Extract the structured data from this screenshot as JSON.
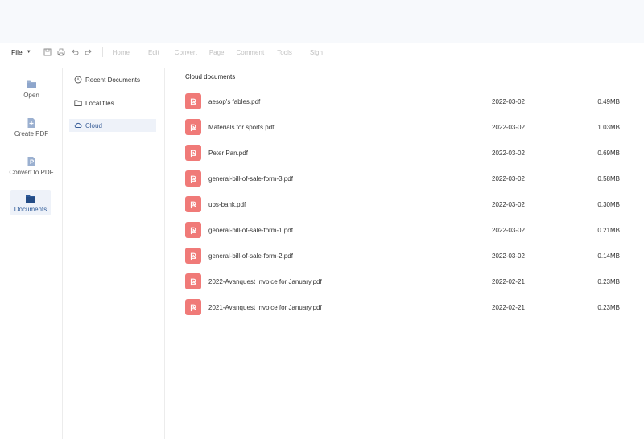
{
  "toolbar": {
    "file_label": "File",
    "icons": [
      "save-icon",
      "print-icon",
      "undo-icon",
      "redo-icon"
    ],
    "menu": [
      "Home",
      "Edit",
      "Convert",
      "Page",
      "Comment",
      "Tools",
      "Sign"
    ]
  },
  "leftnav": {
    "items": [
      {
        "label": "Open",
        "icon": "folder-icon"
      },
      {
        "label": "Create PDF",
        "icon": "create-pdf-icon"
      },
      {
        "label": "Convert to PDF",
        "icon": "convert-pdf-icon"
      },
      {
        "label": "Documents",
        "icon": "documents-folder-icon",
        "active": true
      }
    ]
  },
  "subnav": {
    "items": [
      {
        "label": "Recent Documents",
        "icon": "clock-icon"
      },
      {
        "label": "Local files",
        "icon": "folder-outline-icon"
      },
      {
        "label": "Cloud",
        "icon": "cloud-icon",
        "active": true
      }
    ]
  },
  "main": {
    "title": "Cloud documents",
    "files": [
      {
        "name": "aesop's fables.pdf",
        "date": "2022-03-02",
        "size": "0.49MB"
      },
      {
        "name": "Materials for sports.pdf",
        "date": "2022-03-02",
        "size": "1.03MB"
      },
      {
        "name": "Peter Pan.pdf",
        "date": "2022-03-02",
        "size": "0.69MB"
      },
      {
        "name": "general-bill-of-sale-form-3.pdf",
        "date": "2022-03-02",
        "size": "0.58MB"
      },
      {
        "name": "ubs-bank.pdf",
        "date": "2022-03-02",
        "size": "0.30MB"
      },
      {
        "name": "general-bill-of-sale-form-1.pdf",
        "date": "2022-03-02",
        "size": "0.21MB"
      },
      {
        "name": "general-bill-of-sale-form-2.pdf",
        "date": "2022-03-02",
        "size": "0.14MB"
      },
      {
        "name": "2022-Avanquest Invoice for January.pdf",
        "date": "2022-02-21",
        "size": "0.23MB"
      },
      {
        "name": "2021-Avanquest Invoice for January.pdf",
        "date": "2022-02-21",
        "size": "0.23MB"
      }
    ]
  },
  "colors": {
    "accent": "#2e5a98",
    "pdf_icon": "#f07a78",
    "active_bg": "#eef2f9"
  }
}
